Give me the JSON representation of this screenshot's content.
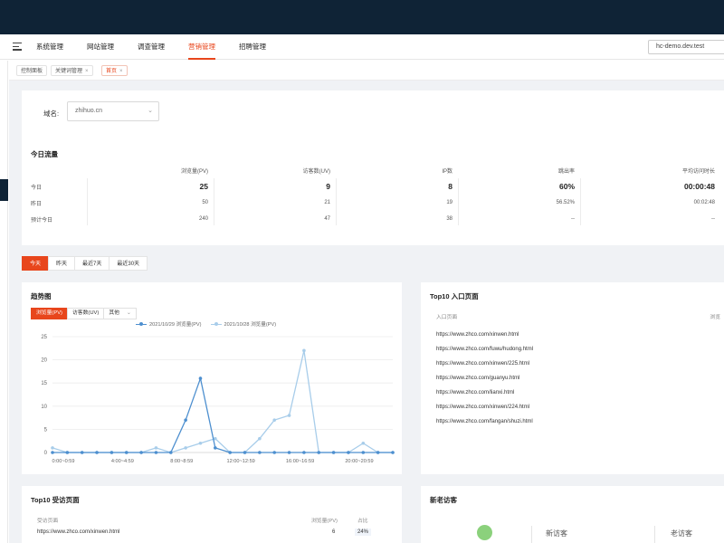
{
  "header": {
    "nav": [
      "系统管理",
      "网站管理",
      "调查管理",
      "营销管理",
      "招聘管理"
    ],
    "active_nav": 3,
    "domain": "hc-demo.dev.test"
  },
  "breadcrumb": [
    "控制面板",
    "关键词管理",
    "首页"
  ],
  "domain_filter": {
    "label": "域名:",
    "value": "zhihuo.cn"
  },
  "traffic": {
    "title": "今日流量",
    "columns": [
      "浏览量(PV)",
      "访客数(UV)",
      "IP数",
      "跳出率",
      "平均访问时长"
    ],
    "rows": [
      {
        "label": "今日",
        "values": [
          "25",
          "9",
          "8",
          "60%",
          "00:00:48"
        ]
      },
      {
        "label": "昨日",
        "values": [
          "50",
          "21",
          "19",
          "56.52%",
          "00:02:48"
        ]
      },
      {
        "label": "预计今日",
        "values": [
          "240",
          "47",
          "38",
          "--",
          "--"
        ]
      }
    ]
  },
  "range_tabs": [
    "今天",
    "昨天",
    "最近7天",
    "最近30天"
  ],
  "trend": {
    "title": "趋势图",
    "tabs": [
      "浏览量(PV)",
      "访客数(UV)",
      "其他"
    ],
    "legend": [
      "2021/10/29 浏览量(PV)",
      "2021/10/28 浏览量(PV)"
    ]
  },
  "chart_data": {
    "type": "line",
    "y_ticks": [
      "0",
      "5",
      "10",
      "15",
      "20",
      "25"
    ],
    "x_ticks": [
      "0:00~0:59",
      "4:00~4:59",
      "8:00~8:59",
      "12:00~12:59",
      "16:00~16:59",
      "20:00~20:59"
    ],
    "ylim": [
      0,
      25
    ],
    "series": [
      {
        "name": "2021/10/29 浏览量(PV)",
        "color": "#4d8fcf",
        "values": [
          0,
          0,
          0,
          0,
          0,
          0,
          0,
          0,
          0,
          7,
          16,
          1,
          0,
          0,
          0,
          0,
          0,
          0,
          0,
          0,
          0,
          0,
          0,
          0
        ]
      },
      {
        "name": "2021/10/28 浏览量(PV)",
        "color": "#a8cdea",
        "values": [
          1,
          0,
          0,
          0,
          0,
          0,
          0,
          1,
          0,
          1,
          2,
          3,
          0,
          0,
          3,
          7,
          8,
          22,
          0,
          0,
          0,
          2,
          0,
          0
        ]
      }
    ]
  },
  "top10_entry": {
    "title": "Top10 入口页面",
    "header": "入口页面",
    "header_right": "浏览",
    "rows": [
      "https://www.zhco.com/xinwen.html",
      "https://www.zhco.com/fuwu/hudong.html",
      "https://www.zhco.com/xinwen/225.html",
      "https://www.zhco.com/guanyu.html",
      "https://www.zhco.com/lianxi.html",
      "https://www.zhco.com/xinwen/224.html",
      "https://www.zhco.com/fangan/shuzi.html"
    ]
  },
  "top10_visited": {
    "title": "Top10 受访页面",
    "header_page": "受访页面",
    "header_pv": "浏览量(PV)",
    "header_pct": "占比",
    "row": {
      "url": "https://www.zhco.com/xinwen.html",
      "pv": "6",
      "pct": "24%"
    }
  },
  "new_old": {
    "title": "新老访客",
    "new_label": "新访客",
    "old_label": "老访客"
  }
}
